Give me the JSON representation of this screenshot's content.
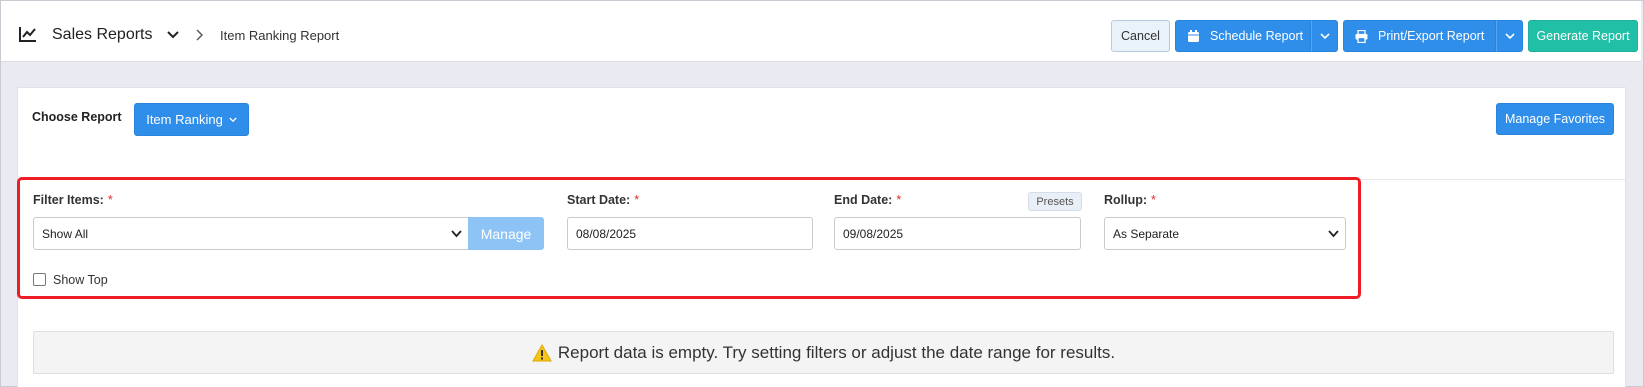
{
  "header": {
    "title": "Sales Reports",
    "breadcrumb": "Item Ranking Report",
    "buttons": {
      "cancel": "Cancel",
      "schedule": "Schedule Report",
      "print_export": "Print/Export Report",
      "generate": "Generate Report"
    }
  },
  "report_picker": {
    "label": "Choose Report",
    "selected": "Item Ranking",
    "manage_favorites": "Manage Favorites"
  },
  "filters": {
    "filter_items": {
      "label": "Filter Items:",
      "required": "*",
      "value": "Show All",
      "manage_label": "Manage"
    },
    "start_date": {
      "label": "Start Date:",
      "required": "*",
      "value": "08/08/2025"
    },
    "end_date": {
      "label": "End Date:",
      "required": "*",
      "value": "09/08/2025",
      "presets_label": "Presets"
    },
    "rollup": {
      "label": "Rollup:",
      "required": "*",
      "value": "As Separate"
    },
    "show_top": {
      "label": "Show Top",
      "checked": false
    }
  },
  "notice": {
    "text": "Report data is empty. Try setting filters or adjust the date range for results."
  },
  "colors": {
    "primary": "#2f8eea",
    "success": "#21bfa5",
    "highlight": "#ee1c24",
    "warning": "#f5c518"
  },
  "icons": {
    "title": "line-chart-icon",
    "schedule": "calendar-icon",
    "print": "printer-icon",
    "notice": "warning-icon"
  }
}
